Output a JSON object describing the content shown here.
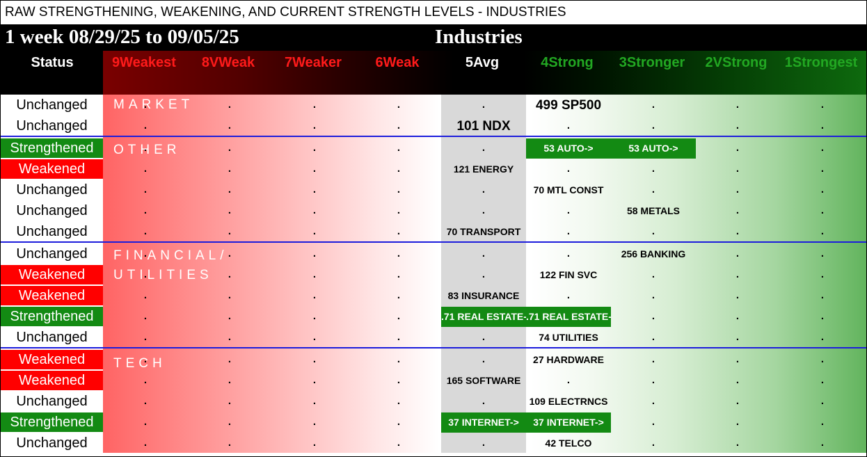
{
  "top_title": "RAW STRENGTHENING, WEAKENING, AND CURRENT STRENGTH LEVELS - INDUSTRIES",
  "week_range": "1 week 08/29/25 to 09/05/25",
  "sheet_title": "Industries",
  "status_header": "Status",
  "columns": [
    {
      "label": "9Weakest",
      "color": "#ff1a1a"
    },
    {
      "label": "8VWeak",
      "color": "#ff1a1a"
    },
    {
      "label": "7Weaker",
      "color": "#ff1a1a"
    },
    {
      "label": "6Weak",
      "color": "#ff1a1a"
    },
    {
      "label": "5Avg",
      "color": "#ffffff"
    },
    {
      "label": "4Strong",
      "color": "#22a822"
    },
    {
      "label": "3Stronger",
      "color": "#22a822"
    },
    {
      "label": "2VStrong",
      "color": "#22a822"
    },
    {
      "label": "1Strongest",
      "color": "#22a822"
    }
  ],
  "dot": ".",
  "sections": [
    {
      "label": "MARKET"
    },
    {
      "label": "OTHER"
    },
    {
      "label": "FINANCIAL/"
    },
    {
      "label": "UTILITIES"
    },
    {
      "label": "TECH"
    }
  ],
  "rows": [
    {
      "status": "Unchanged",
      "state": "unchanged",
      "entries": [
        {
          "col": 5,
          "text": "499 SP500",
          "big": true
        }
      ]
    },
    {
      "status": "Unchanged",
      "state": "unchanged",
      "entries": [
        {
          "col": 4,
          "text": "101 NDX",
          "big": true
        }
      ]
    },
    {
      "status": "Strengthened",
      "state": "strengthened",
      "entries": [
        {
          "col": 5,
          "text": "53 AUTO->",
          "hl": true
        },
        {
          "col": 6,
          "text": "53 AUTO->",
          "hl": true
        }
      ]
    },
    {
      "status": "Weakened",
      "state": "weakened",
      "entries": [
        {
          "col": 4,
          "text": "121 ENERGY"
        }
      ]
    },
    {
      "status": "Unchanged",
      "state": "unchanged",
      "entries": [
        {
          "col": 5,
          "text": "70 MTL CONST"
        }
      ]
    },
    {
      "status": "Unchanged",
      "state": "unchanged",
      "entries": [
        {
          "col": 6,
          "text": "58 METALS"
        }
      ]
    },
    {
      "status": "Unchanged",
      "state": "unchanged",
      "entries": [
        {
          "col": 4,
          "text": "70 TRANSPORT"
        }
      ]
    },
    {
      "status": "Unchanged",
      "state": "unchanged",
      "entries": [
        {
          "col": 6,
          "text": "256 BANKING"
        }
      ]
    },
    {
      "status": "Weakened",
      "state": "weakened",
      "entries": [
        {
          "col": 5,
          "text": "122 FIN SVC"
        }
      ]
    },
    {
      "status": "Weakened",
      "state": "weakened",
      "entries": [
        {
          "col": 4,
          "text": "83 INSURANCE"
        }
      ]
    },
    {
      "status": "Strengthened",
      "state": "strengthened",
      "entries": [
        {
          "col": 4,
          "text": ".71 REAL ESTATE-",
          "hl": true
        },
        {
          "col": 5,
          "text": ".71 REAL ESTATE-",
          "hl": true
        }
      ]
    },
    {
      "status": "Unchanged",
      "state": "unchanged",
      "entries": [
        {
          "col": 5,
          "text": "74 UTILITIES"
        }
      ]
    },
    {
      "status": "Weakened",
      "state": "weakened",
      "entries": [
        {
          "col": 5,
          "text": "27 HARDWARE"
        }
      ]
    },
    {
      "status": "Weakened",
      "state": "weakened",
      "entries": [
        {
          "col": 4,
          "text": "165 SOFTWARE"
        }
      ]
    },
    {
      "status": "Unchanged",
      "state": "unchanged",
      "entries": [
        {
          "col": 5,
          "text": "109 ELECTRNCS"
        }
      ]
    },
    {
      "status": "Strengthened",
      "state": "strengthened",
      "entries": [
        {
          "col": 4,
          "text": "37 INTERNET->",
          "hl": true
        },
        {
          "col": 5,
          "text": "37 INTERNET->",
          "hl": true
        }
      ]
    },
    {
      "status": "Unchanged",
      "state": "unchanged",
      "entries": [
        {
          "col": 5,
          "text": "42 TELCO"
        }
      ]
    }
  ]
}
